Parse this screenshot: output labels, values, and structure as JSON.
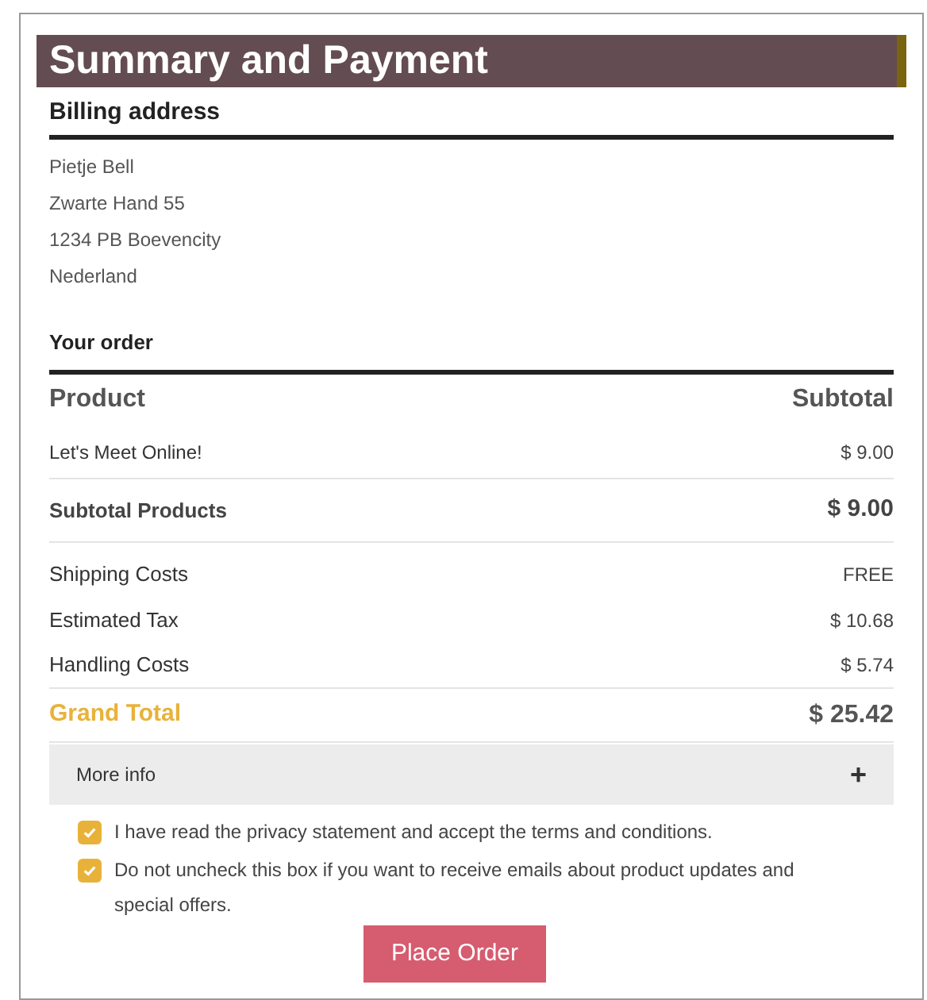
{
  "title": "Summary and Payment",
  "billing": {
    "heading": "Billing address",
    "lines": [
      "Pietje Bell",
      "Zwarte Hand 55",
      "1234 PB Boevencity",
      "Nederland"
    ]
  },
  "order": {
    "heading": "Your order",
    "columns": [
      "Product",
      "Subtotal"
    ],
    "rows": [
      {
        "kind": "item",
        "label": "Let's Meet Online!",
        "value": "$ 9.00"
      },
      {
        "kind": "subtotal",
        "label": "Subtotal Products",
        "value": "$ 9.00"
      },
      {
        "kind": "cost",
        "label": "Shipping Costs",
        "value": "FREE"
      },
      {
        "kind": "cost",
        "label": "Estimated Tax",
        "value": "$ 10.68"
      },
      {
        "kind": "cost",
        "label": "Handling Costs",
        "value": "$ 5.74"
      },
      {
        "kind": "total",
        "label": "Grand Total",
        "value": "$ 25.42"
      }
    ]
  },
  "more_info": {
    "label": "More info",
    "expanded": false,
    "icon": "+"
  },
  "checkboxes": [
    {
      "label": "I have read the privacy statement and accept the terms and conditions.",
      "checked": true
    },
    {
      "label": "Do not uncheck this box if you want to receive emails about product updates and special offers.",
      "checked": true
    }
  ],
  "button": "Place Order"
}
